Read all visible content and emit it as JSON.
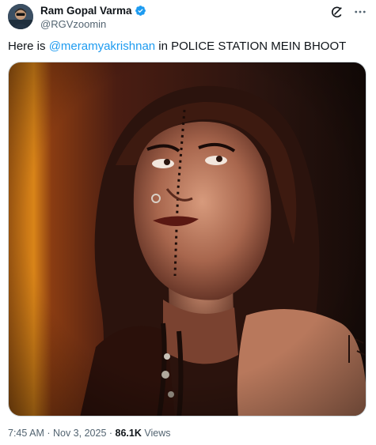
{
  "author": {
    "display_name": "Ram Gopal Varma",
    "handle": "@RGVzoomin",
    "verified": true,
    "avatar_icon": "user-avatar-photo"
  },
  "actions": {
    "grok_icon": "grok-icon",
    "more_icon": "more-options-icon"
  },
  "tweet": {
    "text_before": "Here is ",
    "mention": "@meramyakrishnan",
    "text_after": " in POLICE STATION MEIN BHOOT"
  },
  "media": {
    "type": "photo",
    "icon": "photo-media"
  },
  "meta": {
    "time": "7:45 AM",
    "separator_1": " · ",
    "date": "Nov 3, 2025",
    "separator_2": " · ",
    "views_count": "86.1K",
    "views_label": " Views"
  },
  "colors": {
    "link": "#1d9bf0",
    "verified": "#1d9bf0",
    "secondary_text": "#536471",
    "primary_text": "#0f1419"
  }
}
